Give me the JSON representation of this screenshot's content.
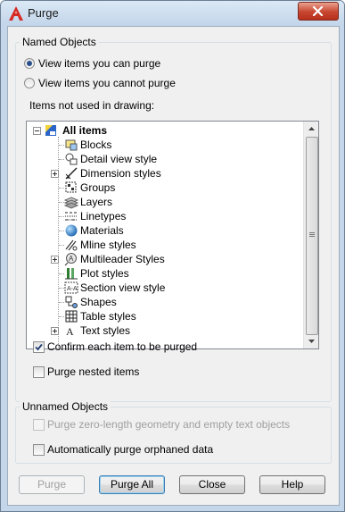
{
  "window": {
    "title": "Purge",
    "app_icon": "autocad-logo-icon",
    "close_icon": "close-icon"
  },
  "named_objects": {
    "group_label": "Named Objects",
    "radio_view_purge": {
      "label": "View items you can purge",
      "selected": true
    },
    "radio_view_cannot": {
      "label": "View items you cannot purge",
      "selected": false
    },
    "tree_label": "Items not used in drawing:",
    "tree": {
      "root": {
        "label": "All items",
        "icon": "drawing-icon",
        "expanded": true
      },
      "items": [
        {
          "label": "Blocks",
          "icon": "blocks-icon",
          "expandable": false
        },
        {
          "label": "Detail view style",
          "icon": "detail-view-icon",
          "expandable": false
        },
        {
          "label": "Dimension styles",
          "icon": "dimension-styles-icon",
          "expandable": true
        },
        {
          "label": "Groups",
          "icon": "groups-icon",
          "expandable": false
        },
        {
          "label": "Layers",
          "icon": "layers-icon",
          "expandable": false
        },
        {
          "label": "Linetypes",
          "icon": "linetypes-icon",
          "expandable": false
        },
        {
          "label": "Materials",
          "icon": "materials-icon",
          "expandable": false
        },
        {
          "label": "Mline styles",
          "icon": "mline-styles-icon",
          "expandable": false
        },
        {
          "label": "Multileader Styles",
          "icon": "multileader-icon",
          "expandable": true
        },
        {
          "label": "Plot styles",
          "icon": "plot-styles-icon",
          "expandable": false
        },
        {
          "label": "Section view style",
          "icon": "section-view-icon",
          "expandable": false
        },
        {
          "label": "Shapes",
          "icon": "shapes-icon",
          "expandable": false
        },
        {
          "label": "Table styles",
          "icon": "table-styles-icon",
          "expandable": false
        },
        {
          "label": "Text styles",
          "icon": "text-styles-icon",
          "expandable": true
        }
      ]
    },
    "confirm_each": {
      "label": "Confirm each item to be purged",
      "checked": true
    },
    "purge_nested": {
      "label": "Purge nested items",
      "checked": false
    }
  },
  "unnamed_objects": {
    "group_label": "Unnamed Objects",
    "purge_zero_length": {
      "label": "Purge zero-length geometry and empty text objects",
      "checked": false,
      "enabled": false
    },
    "auto_purge_orphaned": {
      "label": "Automatically purge orphaned data",
      "checked": false,
      "enabled": true
    }
  },
  "buttons": {
    "purge": {
      "label": "Purge",
      "enabled": false
    },
    "purge_all": {
      "label": "Purge All",
      "enabled": true,
      "default": true
    },
    "close": {
      "label": "Close",
      "enabled": true
    },
    "help": {
      "label": "Help",
      "enabled": true
    }
  },
  "colors": {
    "title_bar": "#c4d6ea",
    "close_button": "#c7452e",
    "dialog_bg": "#f0f0f0"
  }
}
